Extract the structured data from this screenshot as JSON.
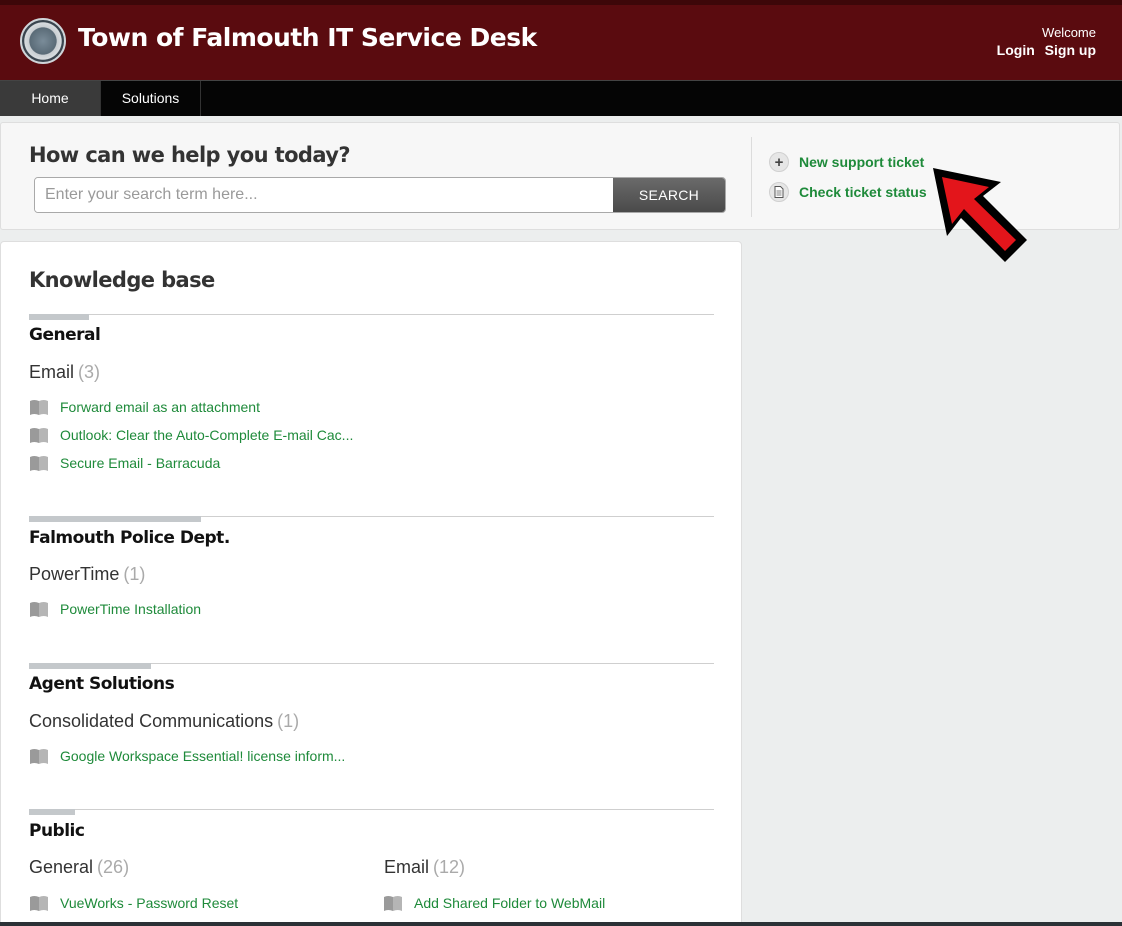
{
  "header": {
    "title": "Town of Falmouth IT Service Desk",
    "welcome": "Welcome",
    "login": "Login",
    "signup": "Sign up",
    "logo_icon": "town-seal-logo"
  },
  "nav": {
    "items": [
      {
        "label": "Home",
        "active": true
      },
      {
        "label": "Solutions",
        "active": false
      }
    ]
  },
  "help": {
    "title": "How can we help you today?",
    "search_placeholder": "Enter your search term here...",
    "search_value": "",
    "search_button": "SEARCH",
    "actions": [
      {
        "label": "New support ticket",
        "icon": "plus-icon"
      },
      {
        "label": "Check ticket status",
        "icon": "document-icon"
      }
    ]
  },
  "kb": {
    "title": "Knowledge base",
    "sections": [
      {
        "title": "General",
        "categories": [
          {
            "name": "Email",
            "count": "(3)",
            "articles": [
              "Forward email as an attachment",
              "Outlook: Clear the Auto-Complete E-mail Cac...",
              "Secure Email - Barracuda"
            ]
          }
        ]
      },
      {
        "title": "Falmouth Police Dept.",
        "categories": [
          {
            "name": "PowerTime",
            "count": "(1)",
            "articles": [
              "PowerTime Installation"
            ]
          }
        ]
      },
      {
        "title": "Agent Solutions",
        "categories": [
          {
            "name": "Consolidated Communications",
            "count": "(1)",
            "articles": [
              "Google Workspace Essential! license inform..."
            ]
          }
        ]
      },
      {
        "title": "Public",
        "categories": [
          {
            "name": "General",
            "count": "(26)",
            "articles": [
              "VueWorks - Password Reset"
            ]
          },
          {
            "name": "Email",
            "count": "(12)",
            "articles": [
              "Add Shared Folder to WebMail"
            ]
          }
        ]
      }
    ]
  },
  "colors": {
    "header_bg": "#5a0b0f",
    "nav_bg": "#050505",
    "link_green": "#1e8a3a",
    "annotation_red": "#e3151b"
  }
}
